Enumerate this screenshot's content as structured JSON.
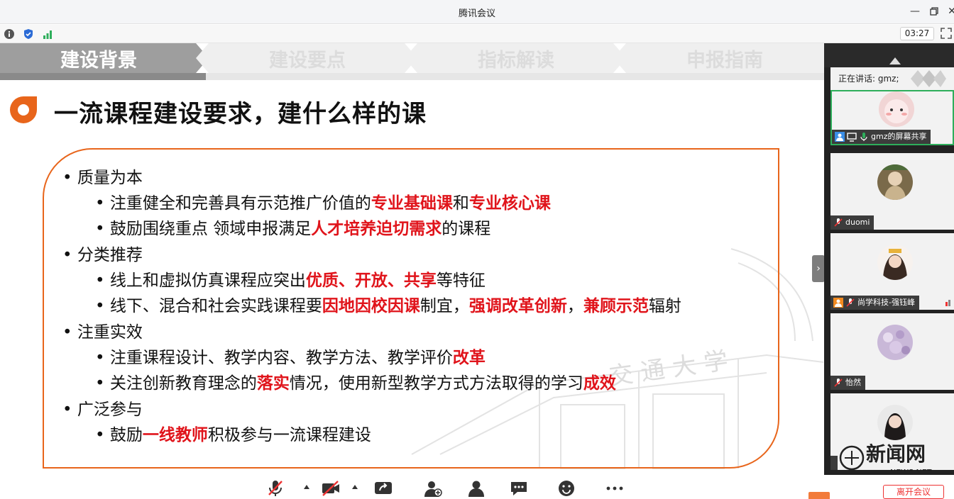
{
  "window": {
    "title": "腾讯会议"
  },
  "status": {
    "time": "03:27"
  },
  "slide": {
    "nav_tabs": [
      "建设背景",
      "建设要点",
      "指标解读",
      "申报指南"
    ],
    "title": "一流课程建设要求，建什么样的课",
    "lines": [
      {
        "level": 1,
        "parts": [
          {
            "t": "质量为本",
            "h": false
          }
        ]
      },
      {
        "level": 2,
        "parts": [
          {
            "t": "注重健全和完善具有示范推广价值的",
            "h": false
          },
          {
            "t": "专业基础课",
            "h": true
          },
          {
            "t": "和",
            "h": false
          },
          {
            "t": "专业核心课",
            "h": true
          }
        ]
      },
      {
        "level": 2,
        "parts": [
          {
            "t": "鼓励围绕重点 领域申报满足",
            "h": false
          },
          {
            "t": "人才培养迫切需求",
            "h": true
          },
          {
            "t": "的课程",
            "h": false
          }
        ]
      },
      {
        "level": 1,
        "parts": [
          {
            "t": "分类推荐",
            "h": false
          }
        ]
      },
      {
        "level": 2,
        "parts": [
          {
            "t": "线上和虚拟仿真课程应突出",
            "h": false
          },
          {
            "t": "优质、开放、共享",
            "h": true
          },
          {
            "t": "等特征",
            "h": false
          }
        ]
      },
      {
        "level": 2,
        "parts": [
          {
            "t": "线下、混合和社会实践课程要",
            "h": false
          },
          {
            "t": "因地因校因课",
            "h": true
          },
          {
            "t": "制宜，",
            "h": false
          },
          {
            "t": "强调改革创新",
            "h": true
          },
          {
            "t": "，",
            "h": false
          },
          {
            "t": "兼顾示范",
            "h": true
          },
          {
            "t": "辐射",
            "h": false
          }
        ]
      },
      {
        "level": 1,
        "parts": [
          {
            "t": "注重实效",
            "h": false
          }
        ]
      },
      {
        "level": 2,
        "parts": [
          {
            "t": "注重课程设计、教学内容、教学方法、教学评价",
            "h": false
          },
          {
            "t": "改革",
            "h": true
          }
        ]
      },
      {
        "level": 2,
        "parts": [
          {
            "t": "关注创新教育理念的",
            "h": false
          },
          {
            "t": "落实",
            "h": true
          },
          {
            "t": "情况，使用新型教学方式方法取得的学习",
            "h": false
          },
          {
            "t": "成效",
            "h": true
          }
        ]
      },
      {
        "level": 1,
        "parts": [
          {
            "t": "广泛参与",
            "h": false
          }
        ]
      },
      {
        "level": 2,
        "parts": [
          {
            "t": "鼓励",
            "h": false
          },
          {
            "t": "一线教师",
            "h": true
          },
          {
            "t": "积极参与一流课程建设",
            "h": false
          }
        ]
      }
    ],
    "watermark_text": "交 通 大 学"
  },
  "panel": {
    "speaking_label": "正在讲话: gmz;",
    "participants": [
      {
        "name": "gmz的屏幕共享",
        "active": true
      },
      {
        "name": "duomi",
        "active": false
      },
      {
        "name": "尚学科技-强钰峰",
        "active": false
      },
      {
        "name": "怡然",
        "active": false
      },
      {
        "name": "",
        "active": false
      }
    ]
  },
  "toolbar": {
    "end_label": "离开会议",
    "logo_text": "新闻网",
    "logo_sub": "NEWS.NET"
  },
  "colors": {
    "accent_orange": "#e8651b",
    "highlight_red": "#e0141b",
    "active_green": "#2eae5b"
  }
}
